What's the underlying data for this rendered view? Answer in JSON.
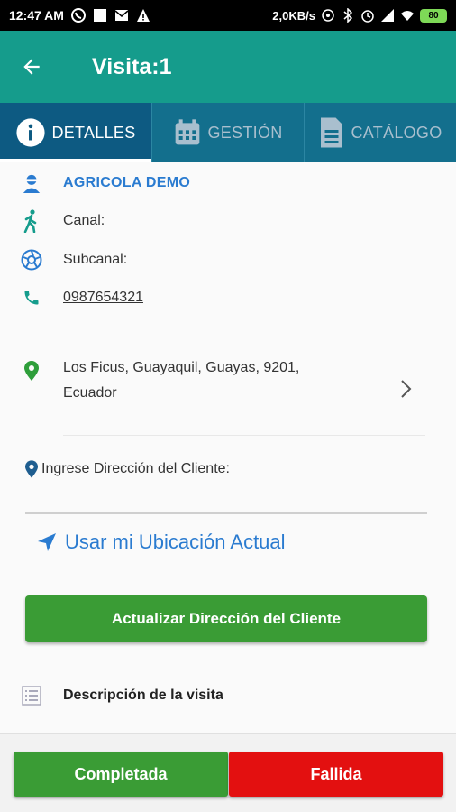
{
  "status_bar": {
    "time": "12:47 AM",
    "net_speed": "2,0KB/s",
    "battery": "80",
    "icons": [
      "whatsapp-icon",
      "square-icon",
      "mail-icon",
      "warning-icon",
      "signal-icon",
      "bluetooth-icon",
      "alarm-icon",
      "wifi-icon"
    ]
  },
  "app_bar": {
    "title": "Visita:1",
    "back_icon": "arrow-left-icon",
    "color": "#159c8c"
  },
  "tabs": [
    {
      "label": "DETALLES",
      "icon": "info-icon",
      "active": true
    },
    {
      "label": "GESTIÓN",
      "icon": "calendar-icon",
      "active": false
    },
    {
      "label": "CATÁLOGO",
      "icon": "document-icon",
      "active": false
    }
  ],
  "client": {
    "name": "AGRICOLA DEMO",
    "canal_label": "Canal:",
    "subcanal_label": "Subcanal:",
    "phone": "0987654321",
    "address": "Los Ficus, Guayaquil, Guayas, 9201, Ecuador"
  },
  "address_form": {
    "label": "Ingrese Dirección del Cliente:",
    "value": "",
    "use_location_label": "Usar mi Ubicación Actual",
    "update_button": "Actualizar Dirección del Cliente"
  },
  "description": {
    "label": "Descripción de la visita"
  },
  "actions": {
    "completed": "Completada",
    "failed": "Fallida"
  },
  "colors": {
    "primary": "#159c8c",
    "tabs": "#136f8d",
    "success": "#3a9c35",
    "danger": "#e31010",
    "link": "#2a7bd0"
  }
}
